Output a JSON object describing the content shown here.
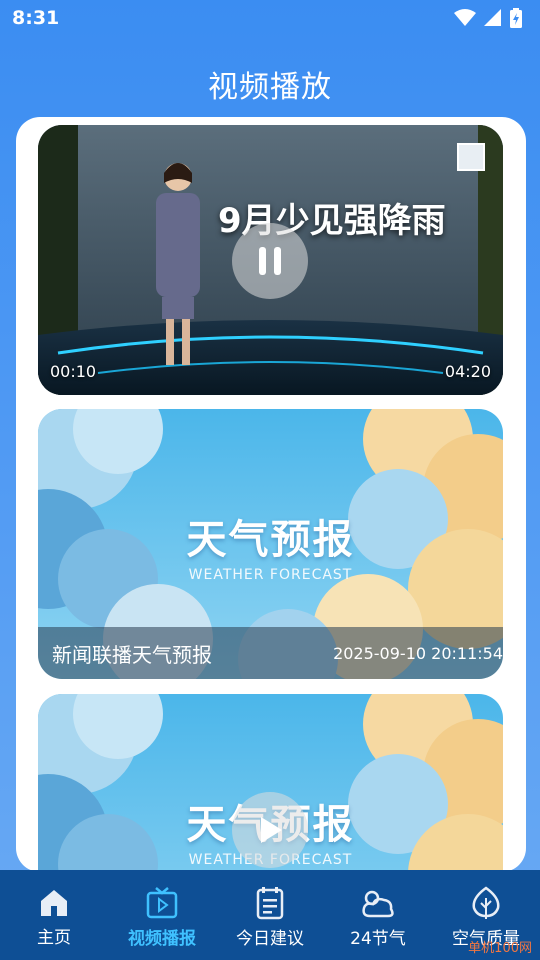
{
  "status_bar": {
    "time": "8:31"
  },
  "header": {
    "title": "视频播放"
  },
  "videos": [
    {
      "headline": "9月少见强降雨",
      "current_time": "00:10",
      "duration": "04:20",
      "state": "playing"
    },
    {
      "forecast_title": "天气预报",
      "forecast_subtitle": "WEATHER FORECAST",
      "caption_title": "新闻联播天气预报",
      "caption_date": "2025-09-10 20:11:54"
    },
    {
      "forecast_title": "天气预报",
      "forecast_subtitle": "WEATHER FORECAST",
      "state": "paused"
    }
  ],
  "tabs": [
    {
      "label": "主页",
      "icon": "home-icon",
      "active": false
    },
    {
      "label": "视频播报",
      "icon": "tv-icon",
      "active": true
    },
    {
      "label": "今日建议",
      "icon": "notes-icon",
      "active": false
    },
    {
      "label": "24节气",
      "icon": "cloud-sun-icon",
      "active": false
    },
    {
      "label": "空气质量",
      "icon": "leaf-icon",
      "active": false
    }
  ],
  "watermark": "单机100网",
  "colors": {
    "active_tab": "#3fc1ff",
    "tab_bar": "#0e4f95",
    "header_gradient": "#3b8df2"
  }
}
